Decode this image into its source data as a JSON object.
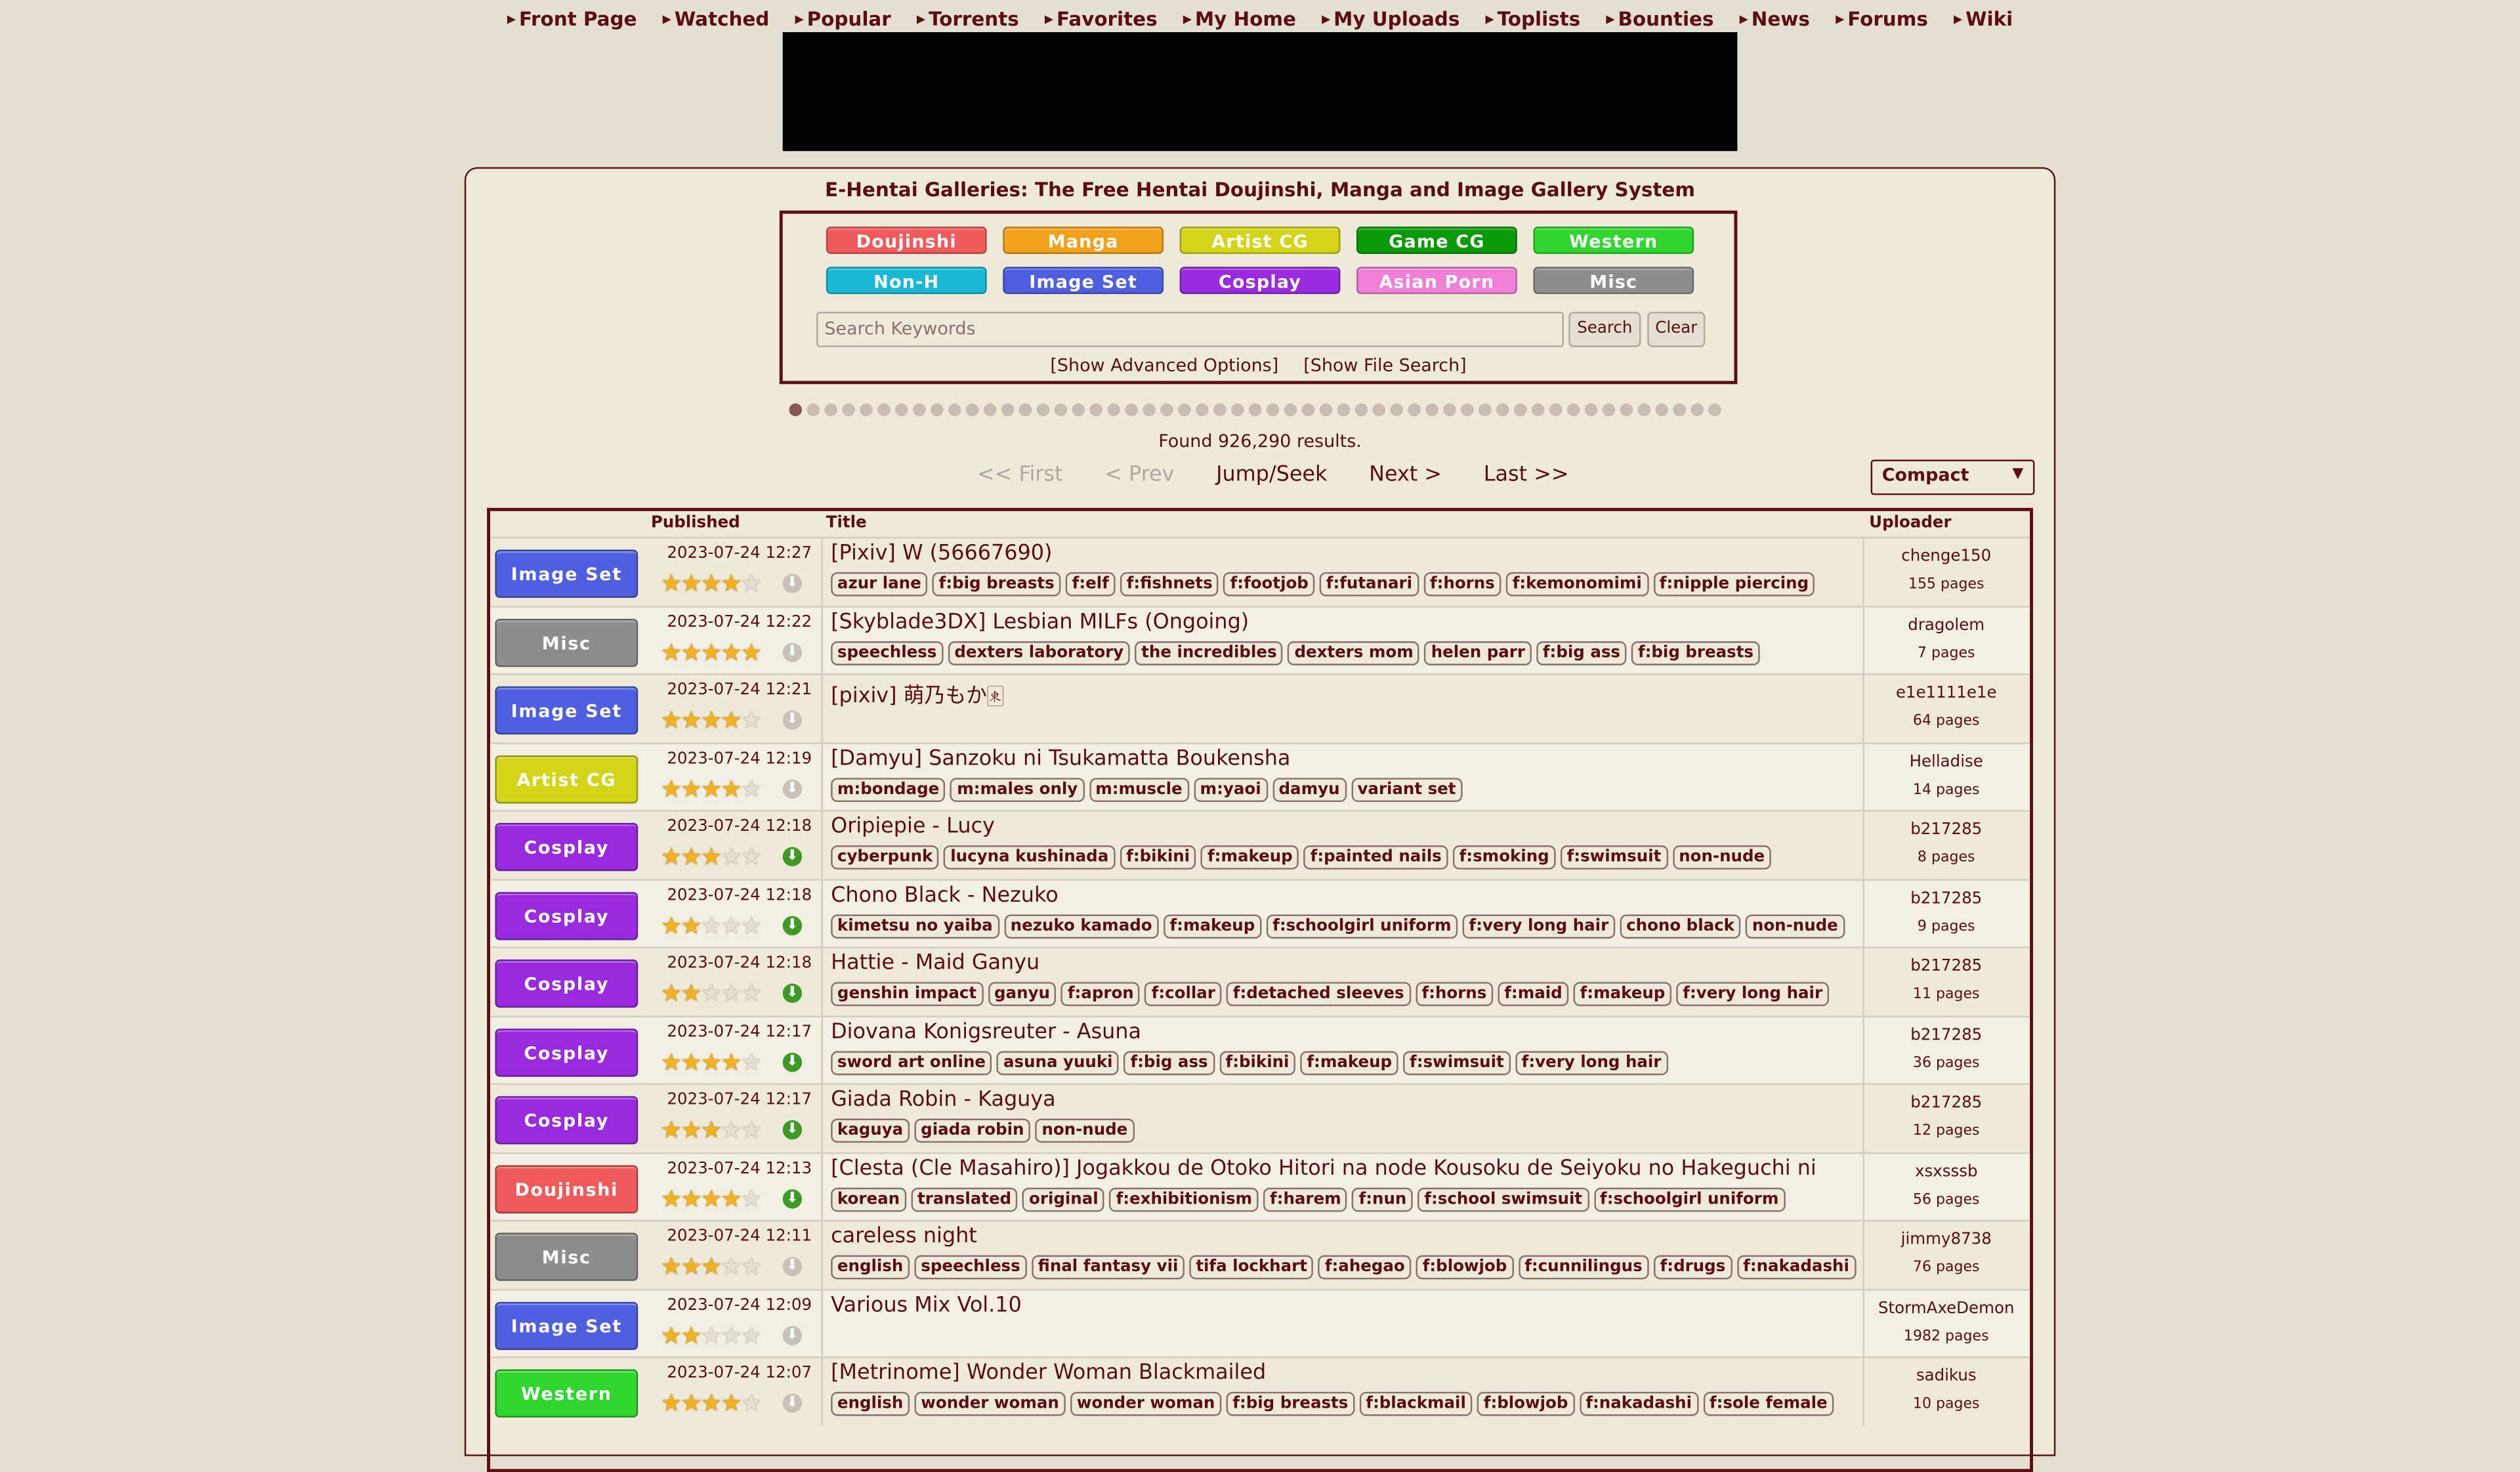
{
  "nav": [
    "Front Page",
    "Watched",
    "Popular",
    "Torrents",
    "Favorites",
    "My Home",
    "My Uploads",
    "Toplists",
    "Bounties",
    "News",
    "Forums",
    "Wiki"
  ],
  "site_title": "E-Hentai Galleries: The Free Hentai Doujinshi, Manga and Image Gallery System",
  "categories": [
    {
      "label": "Doujinshi",
      "color": "#F05A5A"
    },
    {
      "label": "Manga",
      "color": "#F2A11A"
    },
    {
      "label": "Artist CG",
      "color": "#D4D41A"
    },
    {
      "label": "Game CG",
      "color": "#0A9A0A"
    },
    {
      "label": "Western",
      "color": "#2ED62E"
    },
    {
      "label": "Non-H",
      "color": "#1AB8D4"
    },
    {
      "label": "Image Set",
      "color": "#4F5FE0"
    },
    {
      "label": "Cosplay",
      "color": "#9A2AE0"
    },
    {
      "label": "Asian Porn",
      "color": "#EF7FD7"
    },
    {
      "label": "Misc",
      "color": "#8D8D8D"
    }
  ],
  "search": {
    "placeholder": "Search Keywords",
    "search_label": "Search",
    "clear_label": "Clear",
    "advanced": "[Show Advanced Options]",
    "file_search": "[Show File Search]"
  },
  "found": "Found 926,290 results.",
  "pager": {
    "first": "<< First",
    "prev": "< Prev",
    "jump": "Jump/Seek",
    "next": "Next >",
    "last": "Last >>"
  },
  "display_mode": "Compact",
  "columns": {
    "published": "Published",
    "title": "Title",
    "uploader": "Uploader"
  },
  "galleries": [
    {
      "category": "Image Set",
      "date": "2023-07-24 12:27",
      "rating": 4,
      "dl": false,
      "title": "[Pixiv] W (56667690)",
      "tags": [
        "azur lane",
        "f:big breasts",
        "f:elf",
        "f:fishnets",
        "f:footjob",
        "f:futanari",
        "f:horns",
        "f:kemonomimi",
        "f:nipple piercing"
      ],
      "uploader": "chenge150",
      "pages": "155 pages"
    },
    {
      "category": "Misc",
      "date": "2023-07-24 12:22",
      "rating": 5,
      "dl": false,
      "title": "[Skyblade3DX] Lesbian MILFs (Ongoing)",
      "tags": [
        "speechless",
        "dexters laboratory",
        "the incredibles",
        "dexters mom",
        "helen parr",
        "f:big ass",
        "f:big breasts"
      ],
      "uploader": "dragolem",
      "pages": "7 pages"
    },
    {
      "category": "Image Set",
      "date": "2023-07-24 12:21",
      "rating": 4,
      "dl": false,
      "title": "[pixiv] 萌乃もか🀀",
      "tags": [],
      "uploader": "e1e1111e1e",
      "pages": "64 pages"
    },
    {
      "category": "Artist CG",
      "date": "2023-07-24 12:19",
      "rating": 4,
      "dl": false,
      "title": "[Damyu] Sanzoku ni Tsukamatta Boukensha",
      "tags": [
        "m:bondage",
        "m:males only",
        "m:muscle",
        "m:yaoi",
        "damyu",
        "variant set"
      ],
      "uploader": "Helladise",
      "pages": "14 pages"
    },
    {
      "category": "Cosplay",
      "date": "2023-07-24 12:18",
      "rating": 3,
      "dl": true,
      "title": "Oripiepie - Lucy",
      "tags": [
        "cyberpunk",
        "lucyna kushinada",
        "f:bikini",
        "f:makeup",
        "f:painted nails",
        "f:smoking",
        "f:swimsuit",
        "non-nude"
      ],
      "uploader": "b217285",
      "pages": "8 pages"
    },
    {
      "category": "Cosplay",
      "date": "2023-07-24 12:18",
      "rating": 2,
      "dl": true,
      "title": "Chono Black - Nezuko",
      "tags": [
        "kimetsu no yaiba",
        "nezuko kamado",
        "f:makeup",
        "f:schoolgirl uniform",
        "f:very long hair",
        "chono black",
        "non-nude"
      ],
      "uploader": "b217285",
      "pages": "9 pages"
    },
    {
      "category": "Cosplay",
      "date": "2023-07-24 12:18",
      "rating": 2,
      "dl": true,
      "title": "Hattie - Maid Ganyu",
      "tags": [
        "genshin impact",
        "ganyu",
        "f:apron",
        "f:collar",
        "f:detached sleeves",
        "f:horns",
        "f:maid",
        "f:makeup",
        "f:very long hair"
      ],
      "uploader": "b217285",
      "pages": "11 pages"
    },
    {
      "category": "Cosplay",
      "date": "2023-07-24 12:17",
      "rating": 4,
      "dl": true,
      "title": "Diovana Konigsreuter - Asuna",
      "tags": [
        "sword art online",
        "asuna yuuki",
        "f:big ass",
        "f:bikini",
        "f:makeup",
        "f:swimsuit",
        "f:very long hair"
      ],
      "uploader": "b217285",
      "pages": "36 pages"
    },
    {
      "category": "Cosplay",
      "date": "2023-07-24 12:17",
      "rating": 3,
      "dl": true,
      "title": "Giada Robin - Kaguya",
      "tags": [
        "kaguya",
        "giada robin",
        "non-nude"
      ],
      "uploader": "b217285",
      "pages": "12 pages"
    },
    {
      "category": "Doujinshi",
      "date": "2023-07-24 12:13",
      "rating": 4,
      "dl": true,
      "title": "[Clesta (Cle Masahiro)] Jogakkou de Otoko Hitori na node Kousoku de Seiyoku no Hakeguchi ni",
      "tags": [
        "korean",
        "translated",
        "original",
        "f:exhibitionism",
        "f:harem",
        "f:nun",
        "f:school swimsuit",
        "f:schoolgirl uniform"
      ],
      "uploader": "xsxsssb",
      "pages": "56 pages"
    },
    {
      "category": "Misc",
      "date": "2023-07-24 12:11",
      "rating": 3,
      "dl": false,
      "title": "careless night",
      "tags": [
        "english",
        "speechless",
        "final fantasy vii",
        "tifa lockhart",
        "f:ahegao",
        "f:blowjob",
        "f:cunnilingus",
        "f:drugs",
        "f:nakadashi"
      ],
      "uploader": "jimmy8738",
      "pages": "76 pages"
    },
    {
      "category": "Image Set",
      "date": "2023-07-24 12:09",
      "rating": 2,
      "dl": false,
      "title": "Various Mix Vol.10",
      "tags": [],
      "uploader": "StormAxeDemon",
      "pages": "1982 pages"
    },
    {
      "category": "Western",
      "date": "2023-07-24 12:07",
      "rating": 4,
      "dl": false,
      "title": "[Metrinome] Wonder Woman Blackmailed",
      "tags": [
        "english",
        "wonder woman",
        "wonder woman",
        "f:big breasts",
        "f:blackmail",
        "f:blowjob",
        "f:nakadashi",
        "f:sole female"
      ],
      "uploader": "sadikus",
      "pages": "10 pages"
    }
  ]
}
